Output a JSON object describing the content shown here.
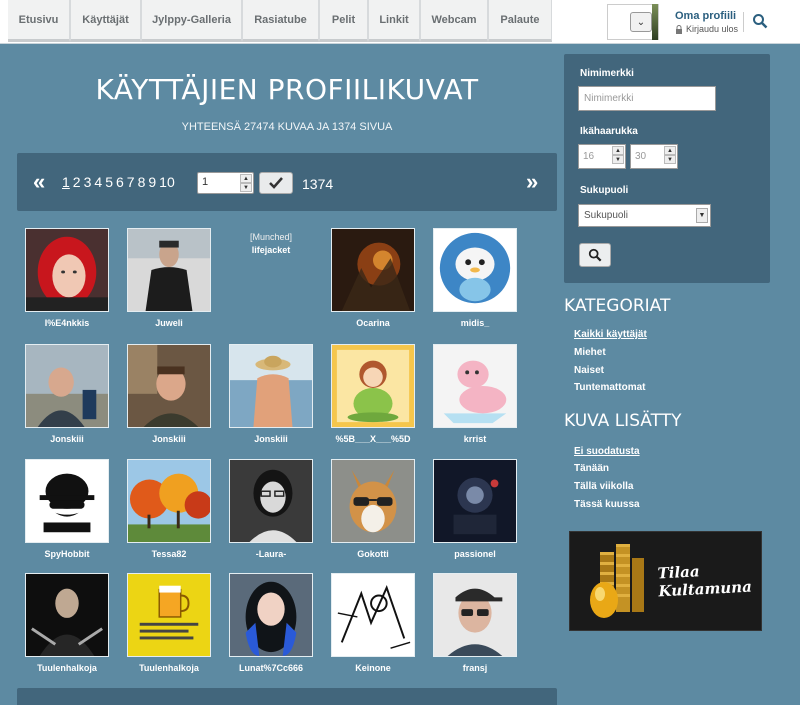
{
  "nav": {
    "tabs": [
      "Etusivu",
      "Käyttäjät",
      "Jylppy-Galleria",
      "Rasiatube",
      "Pelit",
      "Linkit",
      "Webcam",
      "Palaute"
    ]
  },
  "profile": {
    "link_label": "Oma profiili",
    "logout_label": "Kirjaudu ulos"
  },
  "hero": {
    "title": "KÄYTTÄJIEN PROFIILIKUVAT",
    "subtitle": "YHTEENSÄ 27474 KUVAA JA 1374 SIVUA"
  },
  "pager": {
    "prev": "«",
    "next": "»",
    "pages": [
      "1",
      "2",
      "3",
      "4",
      "5",
      "6",
      "7",
      "8",
      "9",
      "10"
    ],
    "current_page_value": "1",
    "total_pages": "1374"
  },
  "users": [
    {
      "name": "I%E4nkkis",
      "icon": "red-hair-girl"
    },
    {
      "name": "Juweli",
      "icon": "man-dark-coat"
    },
    {
      "name": "lifejacket",
      "icon": "munched",
      "munched_label": "[Munched]"
    },
    {
      "name": "Ocarina",
      "icon": "dark-fantasy"
    },
    {
      "name": "midis_",
      "icon": "otter-pokemon"
    },
    {
      "name": "Jonskiii",
      "icon": "man-beach"
    },
    {
      "name": "Jonskiii",
      "icon": "man-room"
    },
    {
      "name": "Jonskiii",
      "icon": "back-hat-lake"
    },
    {
      "name": "%5B___X___%5D",
      "icon": "cartoon-girl"
    },
    {
      "name": "krrist",
      "icon": "pink-seal"
    },
    {
      "name": "SpyHobbit",
      "icon": "spyhobbit-logo"
    },
    {
      "name": "Tessa82",
      "icon": "autumn-trees"
    },
    {
      "name": "-Laura-",
      "icon": "girl-glasses"
    },
    {
      "name": "Gokotti",
      "icon": "corgi-sunglasses"
    },
    {
      "name": "passionel",
      "icon": "dark-robot"
    },
    {
      "name": "Tuulenhalkoja",
      "icon": "assassin"
    },
    {
      "name": "Tuulenhalkoja",
      "icon": "alcohol-beer"
    },
    {
      "name": "Lunat%7Cc666",
      "icon": "blue-hair-girl"
    },
    {
      "name": "Keinone",
      "icon": "comic-sketch"
    },
    {
      "name": "fransj",
      "icon": "guy-cap-glasses"
    }
  ],
  "filter": {
    "nickname_label": "Nimimerkki",
    "nickname_placeholder": "Nimimerkki",
    "age_label": "Ikähaarukka",
    "age_min": "16",
    "age_max": "30",
    "gender_label": "Sukupuoli",
    "gender_selected": "Sukupuoli"
  },
  "categories": {
    "title": "KATEGORIAT",
    "items": [
      "Kaikki käyttäjät",
      "Miehet",
      "Naiset",
      "Tuntemattomat"
    ]
  },
  "added": {
    "title": "KUVA LISÄTTY",
    "items": [
      "Ei suodatusta",
      "Tänään",
      "Tällä viikolla",
      "Tässä kuussa"
    ]
  },
  "ad": {
    "line1": "Tilaa",
    "line2": "Kultamuna"
  },
  "colors": {
    "page_bg": "#5d8aa2",
    "panel_bg": "#42667c",
    "link_blue": "#2b5f7f"
  }
}
